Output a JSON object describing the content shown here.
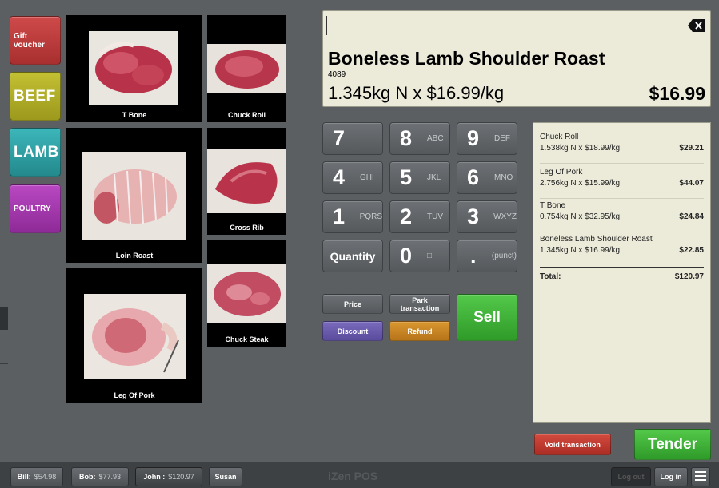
{
  "categories": [
    {
      "label": "Gift voucher",
      "color": "#c03c3c"
    },
    {
      "label": "BEEF",
      "color": "#b5b227"
    },
    {
      "label": "LAMB",
      "color": "#2ea6aa"
    },
    {
      "label": "POULTRY",
      "color": "#a93ab3"
    }
  ],
  "products": {
    "t_bone": "T Bone",
    "chuck_roll": "Chuck Roll",
    "loin_roast": "Loin Roast",
    "cross_rib": "Cross Rib",
    "chuck_steak": "Chuck Steak",
    "leg_of_pork": "Leg Of Pork"
  },
  "display": {
    "name": "Boneless Lamb Shoulder Roast",
    "code": "4089",
    "qty": "1.345kg N x $16.99/kg",
    "total": "$16.99"
  },
  "keypad": {
    "k7": {
      "num": "7",
      "letters": ""
    },
    "k8": {
      "num": "8",
      "letters": "ABC"
    },
    "k9": {
      "num": "9",
      "letters": "DEF"
    },
    "k4": {
      "num": "4",
      "letters": "GHI"
    },
    "k5": {
      "num": "5",
      "letters": "JKL"
    },
    "k6": {
      "num": "6",
      "letters": "MNO"
    },
    "k1": {
      "num": "1",
      "letters": "PQRS"
    },
    "k2": {
      "num": "2",
      "letters": "TUV"
    },
    "k3": {
      "num": "3",
      "letters": "WXYZ"
    },
    "quantity": "Quantity",
    "k0": {
      "num": "0",
      "letters": "□"
    },
    "punct": {
      "num": ".",
      "letters": "(punct)"
    }
  },
  "actions": {
    "price": "Price",
    "park": "Park transaction",
    "sell": "Sell",
    "discount": "Discount",
    "refund": "Refund",
    "void": "Void transaction",
    "tender": "Tender"
  },
  "receipt": {
    "lines": [
      {
        "name": "Chuck Roll",
        "detail": "1.538kg N x $18.99/kg",
        "price": "$29.21"
      },
      {
        "name": "Leg Of Pork",
        "detail": "2.756kg N x $15.99/kg",
        "price": "$44.07"
      },
      {
        "name": "T Bone",
        "detail": "0.754kg N x $32.95/kg",
        "price": "$24.84"
      },
      {
        "name": "Boneless Lamb Shoulder Roast",
        "detail": "1.345kg N x $16.99/kg",
        "price": "$22.85"
      }
    ],
    "total_label": "Total:",
    "total_value": "$120.97"
  },
  "bottom": {
    "tabs": [
      {
        "name": "Bill:",
        "amount": "$54.98"
      },
      {
        "name": "Bob:",
        "amount": "$77.93"
      },
      {
        "name": "John :",
        "amount": "$120.97"
      },
      {
        "name": "Susan",
        "amount": ""
      }
    ],
    "brand": "iZen POS",
    "logout": "Log out",
    "login": "Log in"
  }
}
